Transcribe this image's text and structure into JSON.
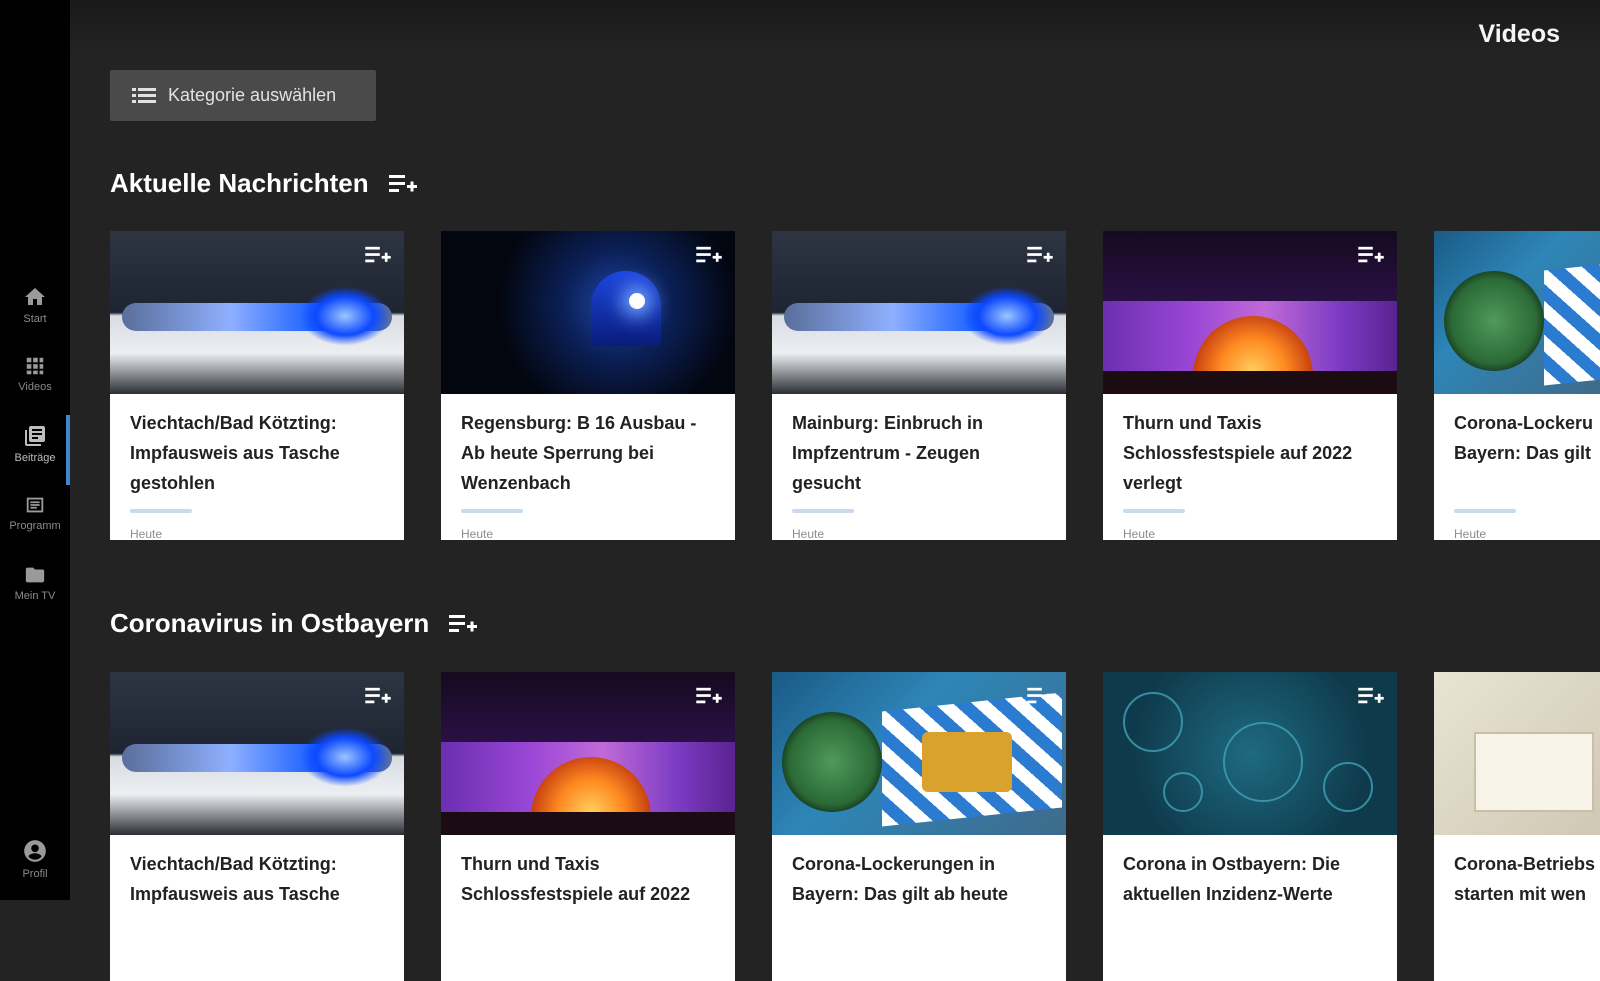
{
  "app": {
    "page_title": "Videos",
    "category_button_label": "Kategorie auswählen"
  },
  "sidebar": {
    "items": [
      {
        "label": "Start",
        "icon": "home-icon"
      },
      {
        "label": "Videos",
        "icon": "grid-icon"
      },
      {
        "label": "Beiträge",
        "icon": "library-icon",
        "active": true
      },
      {
        "label": "Programm",
        "icon": "list-icon"
      },
      {
        "label": "Mein TV",
        "icon": "folder-icon"
      }
    ],
    "profile": {
      "label": "Profil",
      "icon": "account-icon"
    }
  },
  "sections": [
    {
      "title": "Aktuelle Nachrichten",
      "cards": [
        {
          "title": "Viechtach/Bad Kötzting: Impfausweis aus Tasche gestohlen",
          "date": "Heute",
          "thumb": "police-car"
        },
        {
          "title": "Regensburg: B 16 Ausbau - Ab heute Sperrung bei Wenzenbach",
          "date": "Heute",
          "thumb": "siren"
        },
        {
          "title": "Mainburg: Einbruch in Impfzentrum - Zeugen gesucht",
          "date": "Heute",
          "thumb": "police-car"
        },
        {
          "title": "Thurn und Taxis Schlossfestspiele auf 2022 verlegt",
          "date": "Heute",
          "thumb": "castle-concert"
        },
        {
          "title": "Corona-Lockeru Bayern: Das gilt",
          "date": "Heute",
          "thumb": "virus-flag"
        }
      ]
    },
    {
      "title": "Coronavirus in Ostbayern",
      "cards": [
        {
          "title": "Viechtach/Bad Kötzting: Impfausweis aus Tasche",
          "thumb": "police-car"
        },
        {
          "title": "Thurn und Taxis Schlossfestspiele auf 2022",
          "thumb": "castle-concert"
        },
        {
          "title": "Corona-Lockerungen in Bayern: Das gilt ab heute",
          "thumb": "virus-flag"
        },
        {
          "title": "Corona in Ostbayern: Die aktuellen Inzidenz-Werte",
          "thumb": "incidence"
        },
        {
          "title": "Corona-Betriebs starten mit wen",
          "thumb": "test-kit"
        }
      ]
    }
  ],
  "colors": {
    "background": "#232323",
    "sidebar": "#000000",
    "accent": "#3e86c8",
    "card": "#ffffff"
  }
}
